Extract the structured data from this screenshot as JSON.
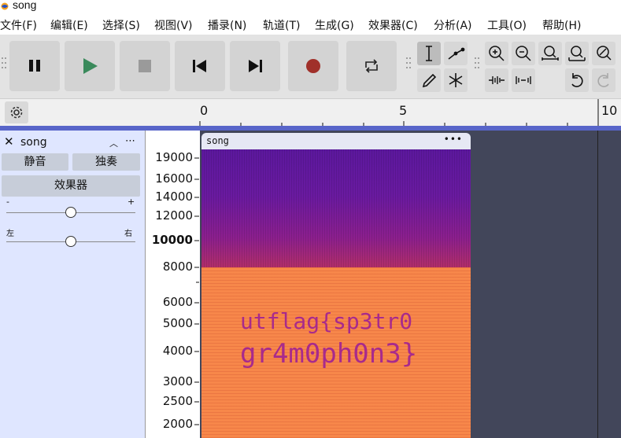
{
  "window": {
    "title": "song"
  },
  "menu": [
    "文件(F)",
    "编辑(E)",
    "选择(S)",
    "视图(V)",
    "播录(N)",
    "轨道(T)",
    "生成(G)",
    "效果器(C)",
    "分析(A)",
    "工具(O)",
    "帮助(H)"
  ],
  "toolbar": {
    "transport": [
      "pause-icon",
      "play-icon",
      "stop-icon",
      "skip-start-icon",
      "skip-end-icon",
      "record-icon",
      "loop-icon"
    ],
    "tools": [
      "selection-tool-icon",
      "envelope-tool-icon",
      "draw-tool-icon",
      "multi-tool-icon"
    ],
    "zoom": [
      "zoom-in-icon",
      "zoom-out-icon",
      "fit-selection-icon",
      "fit-project-icon",
      "zoom-toggle-icon",
      "trim-outside-icon",
      "silence-selection-icon",
      "undo-icon",
      "redo-icon"
    ],
    "colors": {
      "play": "#3a8a5b",
      "record": "#a0302a"
    }
  },
  "timeline": {
    "labels": [
      "0",
      "5",
      "10"
    ]
  },
  "track": {
    "name": "song",
    "mute_label": "静音",
    "solo_label": "独奏",
    "effects_label": "效果器",
    "gain_min": "-",
    "gain_max": "+",
    "pan_left": "左",
    "pan_right": "右",
    "gain_level": 0.5,
    "pan_level": 0.5
  },
  "scale": {
    "ticks": [
      "19000",
      "16000",
      "14000",
      "12000",
      "10000",
      "8000",
      "6000",
      "5000",
      "4000",
      "3000",
      "2500",
      "2000"
    ]
  },
  "clip": {
    "name": "song",
    "menu": "•••",
    "flag_line1": "utflag{sp3tr0",
    "flag_line2": "gr4m0ph0n3}"
  }
}
